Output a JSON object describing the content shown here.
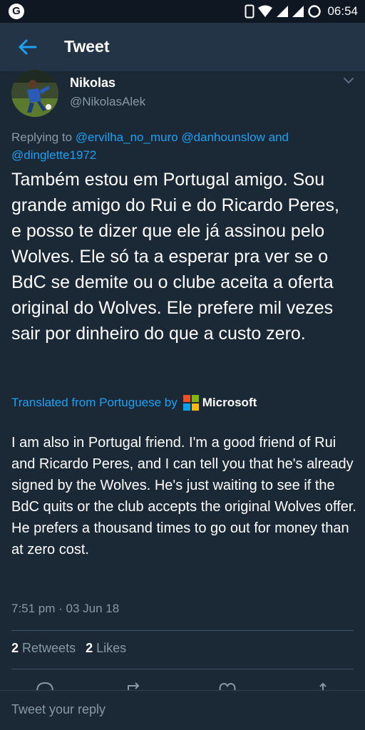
{
  "status_bar": {
    "app_icon": "G",
    "time": "06:54",
    "icons": [
      "phone-icon",
      "wifi-icon",
      "signal-icon",
      "signal-icon",
      "alarm-icon"
    ]
  },
  "app_bar": {
    "title": "Tweet",
    "back_icon": "arrow-left-icon"
  },
  "tweet": {
    "author_name": "Nikolas",
    "author_handle": "@NikolasAlek",
    "reply_prefix": "Replying to",
    "reply_users": [
      "@ervilha_no_muro",
      "@danhounslow",
      "@dinglette1972"
    ],
    "reply_and": "and",
    "text": "Também estou em Portugal amigo. Sou grande amigo do Rui e do Ricardo Peres, e posso te dizer que ele já assinou pelo Wolves. Ele só ta a esperar pra ver se o BdC se demite ou o clube aceita a oferta original do Wolves. Ele prefere mil vezes sair por dinheiro do que a custo zero.",
    "translated_label": "Translated from Portuguese by",
    "translator_name": "Microsoft",
    "translation": "I am also in Portugal friend. I'm a good friend of Rui and Ricardo Peres, and I can tell you that he's already signed by the Wolves. He's just waiting to see if the BdC quits or the club accepts the original Wolves offer. He prefers a thousand times to go out for money than at zero cost.",
    "timestamp": "7:51 pm · 03 Jun 18",
    "retweets_count": "2",
    "retweets_label": "Retweets",
    "likes_count": "2",
    "likes_label": "Likes"
  },
  "reply_bar": {
    "placeholder": "Tweet your reply"
  },
  "colors": {
    "background": "#1b2836",
    "header": "#243447",
    "status_bar": "#0e1722",
    "accent": "#1da1f2",
    "secondary_text": "#8899a6"
  }
}
